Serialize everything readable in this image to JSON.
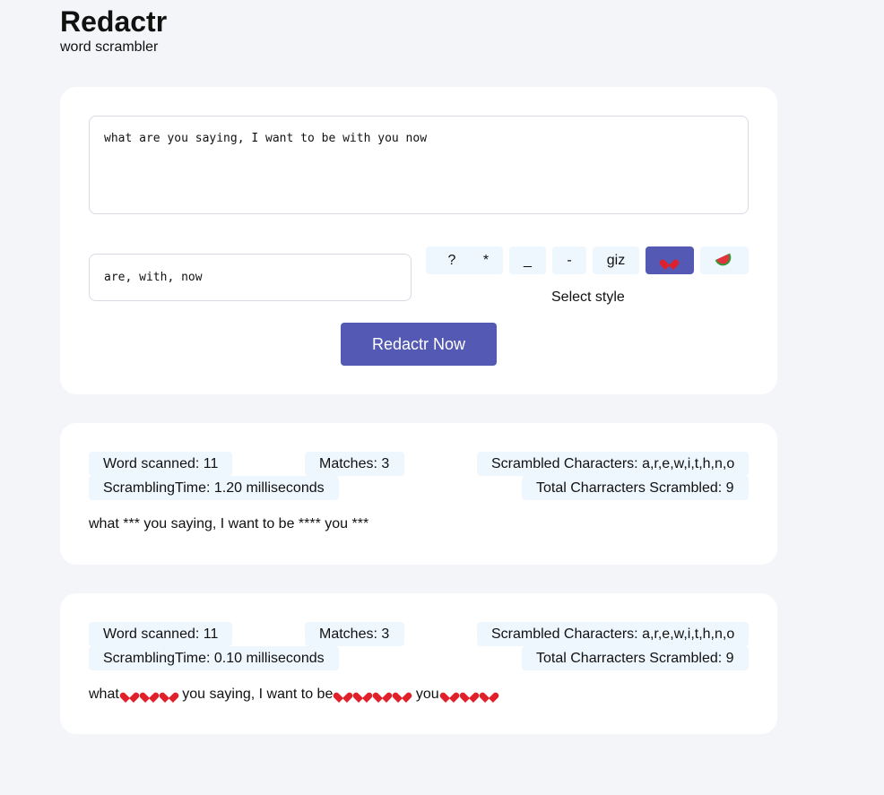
{
  "app": {
    "title": "Redactr",
    "subtitle": "word scrambler"
  },
  "input": {
    "text": "what are you saying, I want to be with you now",
    "words": "are, with, now"
  },
  "styles": {
    "options": [
      {
        "label": "?",
        "name": "question"
      },
      {
        "label": "*",
        "name": "asterisk"
      },
      {
        "label": "_",
        "name": "underscore"
      },
      {
        "label": "-",
        "name": "dash"
      },
      {
        "label": "giz",
        "name": "giz"
      },
      {
        "label": "",
        "name": "heart",
        "icon": "heart-icon",
        "active": true
      },
      {
        "label": "",
        "name": "watermelon",
        "icon": "watermelon-icon"
      }
    ],
    "select_label": "Select style"
  },
  "actions": {
    "redact_label": "Redactr Now"
  },
  "colors": {
    "accent": "#5459b3",
    "stat_bg": "#eef6fe",
    "page_bg": "#f4f5f9",
    "heart": "#e0202a"
  },
  "results": [
    {
      "word_scanned": "Word scanned: 11",
      "matches": "Matches: 3",
      "scrambled_chars": "Scrambled Characters: a,r,e,w,i,t,h,n,o",
      "scrambling_time": "ScramblingTime: 1.20 milliseconds",
      "total_scrambled": "Total Charracters Scrambled: 9",
      "output": "what *** you saying, I want to be **** you ***"
    },
    {
      "word_scanned": "Word scanned: 11",
      "matches": "Matches: 3",
      "scrambled_chars": "Scrambled Characters: a,r,e,w,i,t,h,n,o",
      "scrambling_time": "ScramblingTime: 0.10 milliseconds",
      "total_scrambled": "Total Charracters Scrambled: 9",
      "output_parts": [
        "what",
        "you saying, I want to be",
        "you"
      ]
    }
  ]
}
